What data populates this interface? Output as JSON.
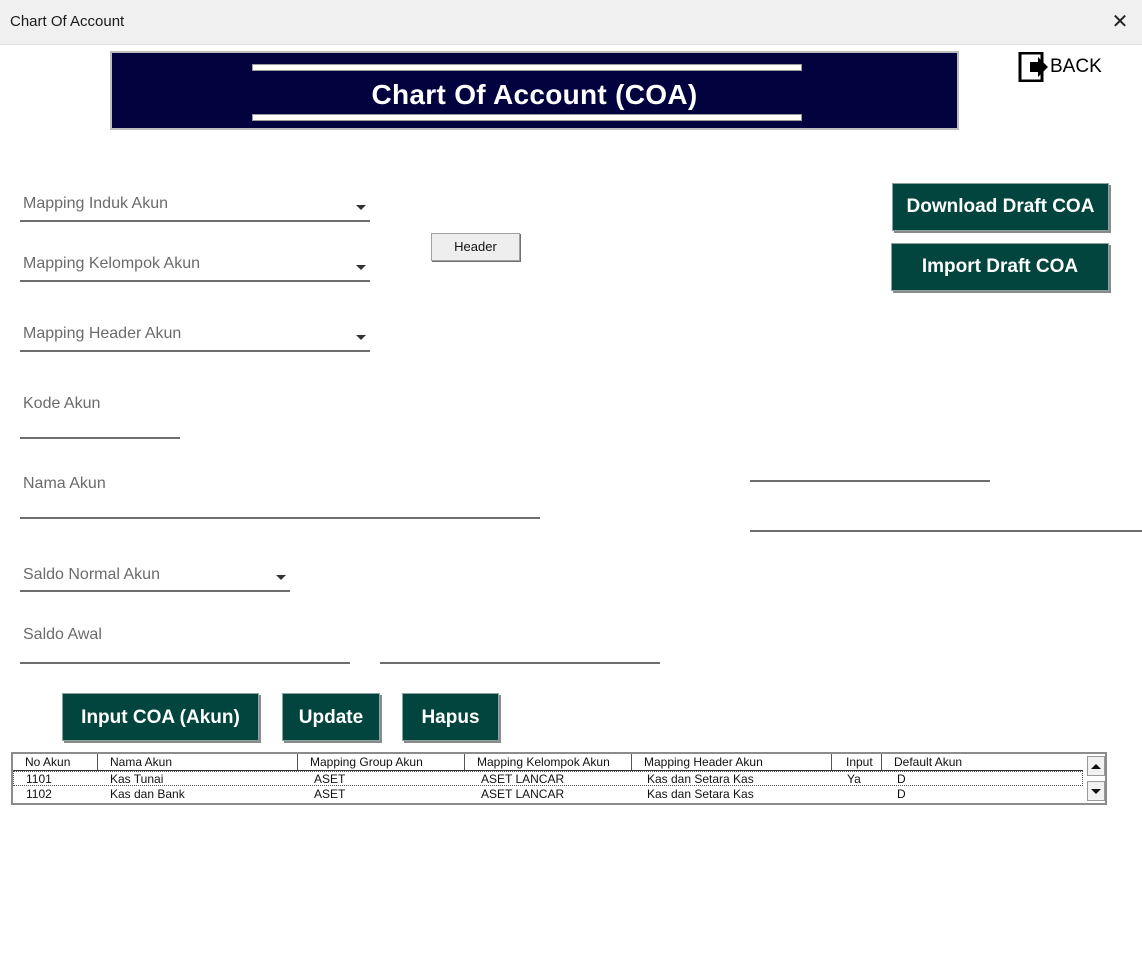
{
  "window": {
    "title": "Chart Of Account",
    "close_glyph": "✕"
  },
  "banner": {
    "title": "Chart Of Account (COA)"
  },
  "back": {
    "label": "BACK",
    "icon": "exit-door-arrow-icon"
  },
  "form": {
    "mapping_induk": "Mapping Induk Akun",
    "mapping_kelompok": "Mapping Kelompok Akun",
    "mapping_header": "Mapping Header Akun",
    "kode_akun": "Kode Akun",
    "nama_akun": "Nama Akun",
    "saldo_normal": "Saldo Normal Akun",
    "saldo_awal": "Saldo Awal"
  },
  "buttons": {
    "header": "Header",
    "download_draft": "Download Draft COA",
    "import_draft": "Import Draft COA",
    "input_coa": "Input COA (Akun)",
    "update": "Update",
    "hapus": "Hapus"
  },
  "grid": {
    "columns": [
      "No Akun",
      "Nama Akun",
      "Mapping Group Akun",
      "Mapping Kelompok Akun",
      "Mapping Header Akun",
      "Input",
      "Default Akun"
    ],
    "rows": [
      [
        "1101",
        "Kas Tunai",
        "ASET",
        "ASET LANCAR",
        "Kas dan Setara Kas",
        "Ya",
        "D"
      ],
      [
        "1102",
        "Kas dan Bank",
        "ASET",
        "ASET LANCAR",
        "Kas dan Setara Kas",
        "",
        "D"
      ]
    ]
  },
  "colors": {
    "banner_bg": "#02023f",
    "button_green": "#02453e"
  }
}
